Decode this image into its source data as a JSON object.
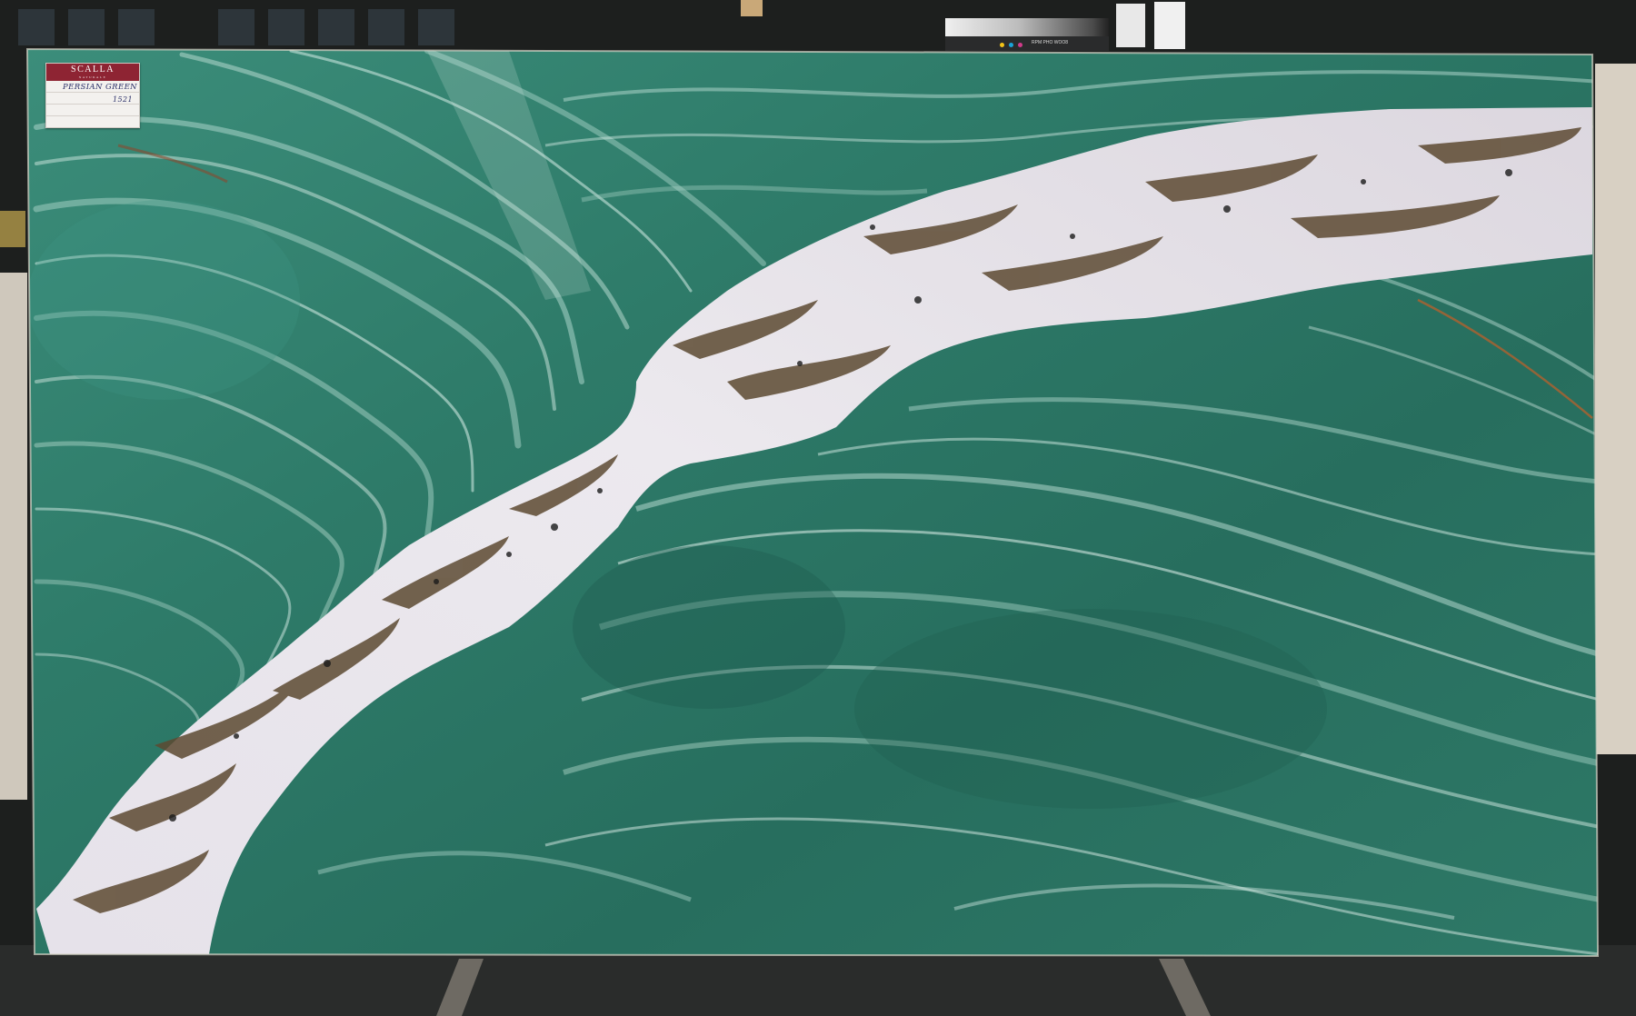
{
  "photo": {
    "subject": "",
    "colors": {
      "slab_green": "#2f7a68",
      "slab_green_dark": "#1f5e50",
      "vein_white": "#e9e6ea",
      "vein_brown": "#5d4a32",
      "backdrop": "#1c1e1d",
      "label_maroon": "#8e2433",
      "handwriting_ink": "#2a2f68"
    }
  },
  "label": {
    "brand": "SCALLA",
    "brand_sub": "NATURALE",
    "material": "PERSIAN GREEN",
    "number": "1521"
  },
  "wall_chart": {
    "text": "RPM PHO WOO8"
  }
}
